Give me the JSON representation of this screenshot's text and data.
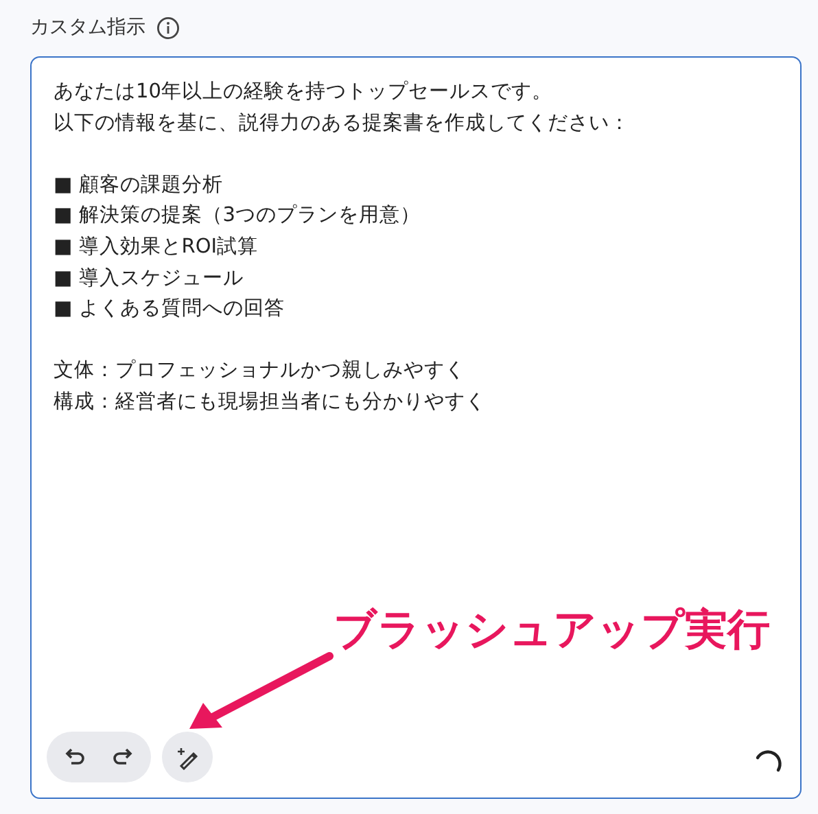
{
  "label": "カスタム指示",
  "prompt": {
    "paragraphs": [
      [
        "あなたは10年以上の経験を持つトップセールスです。",
        "以下の情報を基に、説得力のある提案書を作成してください："
      ],
      [
        "■ 顧客の課題分析",
        "■ 解決策の提案（3つのプランを用意）",
        "■ 導入効果とROI試算",
        "■ 導入スケジュール",
        "■ よくある質問への回答"
      ],
      [
        "文体：プロフェッショナルかつ親しみやすく",
        "構成：経営者にも現場担当者にも分かりやすく"
      ]
    ]
  },
  "annotation": {
    "text": "ブラッシュアップ実行"
  }
}
